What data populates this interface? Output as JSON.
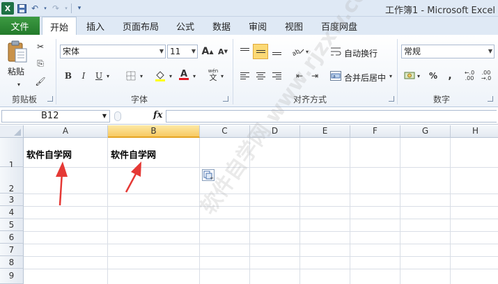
{
  "window": {
    "title": "工作簿1 - Microsoft Excel"
  },
  "colors": {
    "file_tab": "#2e7d32",
    "accent_select": "#fbd975",
    "arrow": "#e53935"
  },
  "tabs": [
    {
      "label": "文件"
    },
    {
      "label": "开始",
      "active": true
    },
    {
      "label": "插入"
    },
    {
      "label": "页面布局"
    },
    {
      "label": "公式"
    },
    {
      "label": "数据"
    },
    {
      "label": "审阅"
    },
    {
      "label": "视图"
    },
    {
      "label": "百度网盘"
    }
  ],
  "ribbon": {
    "clipboard": {
      "label": "剪贴板",
      "paste": "粘贴"
    },
    "font": {
      "label": "字体",
      "font_name": "宋体",
      "font_size": "11",
      "bold": "B",
      "italic": "I",
      "underline": "U"
    },
    "alignment": {
      "label": "对齐方式",
      "wrap_text": "自动换行",
      "merge_center": "合并后居中"
    },
    "number": {
      "label": "数字",
      "format": "常规",
      "percent": "%",
      "comma": ","
    }
  },
  "formula_bar": {
    "name_box": "B12",
    "fx": "fx",
    "value": ""
  },
  "sheet": {
    "columns": [
      "A",
      "B",
      "C",
      "D",
      "E",
      "F",
      "G",
      "H"
    ],
    "selected_column": "B",
    "rows": [
      "1",
      "2",
      "3",
      "4",
      "5",
      "6",
      "7",
      "8",
      "9"
    ],
    "cells": {
      "A1": "软件自学网",
      "B1": "软件自学网"
    }
  },
  "watermark": "软件自学网 www.rjzxw.com"
}
